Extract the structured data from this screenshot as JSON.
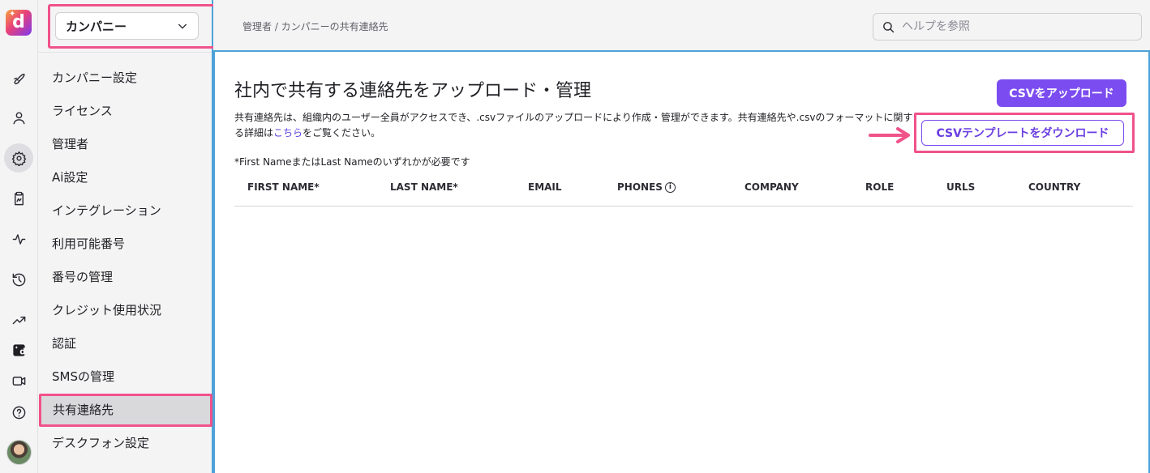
{
  "rail": {
    "icons": [
      "rocket-icon",
      "user-icon",
      "gear-icon",
      "clipboard-icon",
      "activity-icon",
      "history-icon",
      "trending-icon",
      "dialpad-logo-icon",
      "video-icon",
      "help-icon"
    ]
  },
  "sidebar": {
    "company_select": "カンパニー",
    "items": [
      {
        "label": "カンパニー設定"
      },
      {
        "label": "ライセンス"
      },
      {
        "label": "管理者"
      },
      {
        "label": "Ai設定"
      },
      {
        "label": "インテグレーション"
      },
      {
        "label": "利用可能番号"
      },
      {
        "label": "番号の管理"
      },
      {
        "label": "クレジット使用状況"
      },
      {
        "label": "認証"
      },
      {
        "label": "SMSの管理"
      },
      {
        "label": "共有連絡先"
      },
      {
        "label": "デスクフォン設定"
      }
    ],
    "selected": "共有連絡先"
  },
  "header": {
    "breadcrumb": "管理者 / カンパニーの共有連絡先",
    "search_placeholder": "ヘルプを参照"
  },
  "main": {
    "title": "社内で共有する連絡先をアップロード・管理",
    "desc_before_link": "共有連絡先は、組織内のユーザー全員がアクセスでき、.csvファイルのアップロードにより作成・管理ができます。共有連絡先や.csvのフォーマットに関する詳細は",
    "desc_link": "こちら",
    "desc_after_link": "をご覧ください。",
    "note": "*First NameまたはLast Nameのいずれかが必要です",
    "upload_button": "CSVをアップロード",
    "template_button": "CSVテンプレートをダウンロード",
    "columns": [
      "FIRST NAME*",
      "LAST NAME*",
      "EMAIL",
      "PHONES",
      "COMPANY",
      "ROLE",
      "URLS",
      "COUNTRY"
    ],
    "phones_info_glyph": "i"
  },
  "colors": {
    "accent": "#7b4cf0",
    "highlight": "#f0528a",
    "focus_border": "#4da3d8"
  }
}
